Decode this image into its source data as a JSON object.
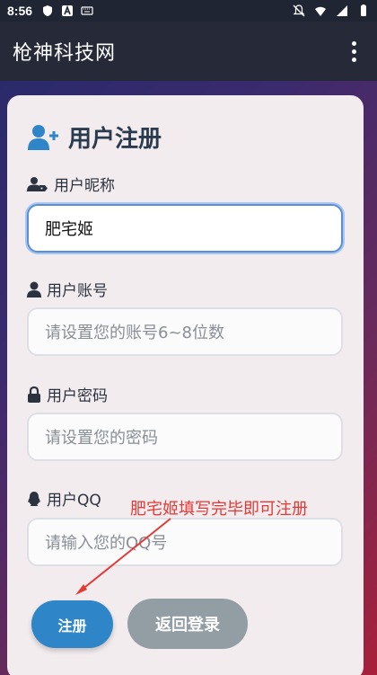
{
  "status": {
    "time": "8:56"
  },
  "appbar": {
    "title": "枪神科技网"
  },
  "form": {
    "heading": "用户注册",
    "nickname": {
      "label": "用户昵称",
      "value": "肥宅姬"
    },
    "account": {
      "label": "用户账号",
      "placeholder": "请设置您的账号6~8位数"
    },
    "password": {
      "label": "用户密码",
      "placeholder": "请设置您的密码"
    },
    "qq": {
      "label": "用户QQ",
      "placeholder": "请输入您的QQ号"
    }
  },
  "annotation": {
    "text": "肥宅姬填写完毕即可注册",
    "color": "#e53935"
  },
  "buttons": {
    "register": "注册",
    "back_login": "返回登录"
  },
  "colors": {
    "accent": "#2e86c8",
    "secondary": "#939ea4"
  }
}
